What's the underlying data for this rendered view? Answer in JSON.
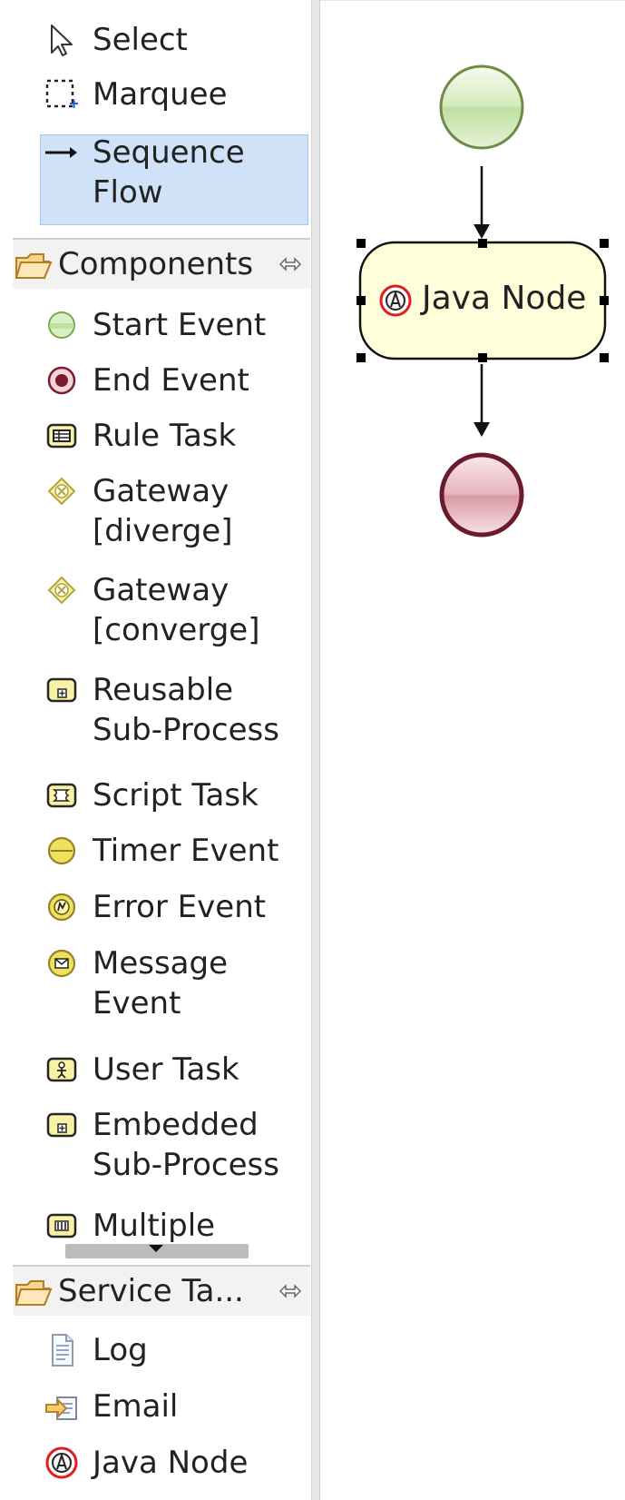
{
  "palette": {
    "tools": [
      {
        "name": "select",
        "label": "Select",
        "icon": "arrow-cursor-icon"
      },
      {
        "name": "marquee",
        "label": "Marquee",
        "icon": "dashed-marquee-icon"
      },
      {
        "name": "sequence-flow",
        "label_lines": [
          "Sequence",
          "Flow"
        ],
        "icon": "right-arrow-icon",
        "selected": true
      }
    ],
    "components_drawer": {
      "title": "Components",
      "items": [
        {
          "label": "Start Event",
          "icon": "start-event-icon"
        },
        {
          "label": "End Event",
          "icon": "end-event-icon"
        },
        {
          "label": "Rule Task",
          "icon": "rule-task-icon"
        },
        {
          "label_lines": [
            "Gateway",
            "[diverge]"
          ],
          "icon": "gateway-diverge-icon"
        },
        {
          "label_lines": [
            "Gateway",
            "[converge]"
          ],
          "icon": "gateway-converge-icon"
        },
        {
          "label_lines": [
            "Reusable",
            "Sub-Process"
          ],
          "icon": "reusable-subprocess-icon"
        },
        {
          "label": "Script Task",
          "icon": "script-task-icon"
        },
        {
          "label": "Timer Event",
          "icon": "timer-event-icon"
        },
        {
          "label": "Error Event",
          "icon": "error-event-icon"
        },
        {
          "label_lines": [
            "Message",
            "Event"
          ],
          "icon": "message-event-icon"
        },
        {
          "label": "User Task",
          "icon": "user-task-icon"
        },
        {
          "label_lines": [
            "Embedded",
            "Sub-Process"
          ],
          "icon": "embedded-subprocess-icon"
        },
        {
          "label": "Multiple",
          "icon": "multiple-instances-icon"
        }
      ]
    },
    "service_tasks_drawer": {
      "title": "Service Ta...",
      "items": [
        {
          "label": "Log",
          "icon": "log-document-icon"
        },
        {
          "label": "Email",
          "icon": "email-icon"
        },
        {
          "label": "Java Node",
          "icon": "java-node-icon"
        }
      ]
    }
  },
  "canvas": {
    "java_node": {
      "label": "Java Node",
      "selected": true
    }
  },
  "colors": {
    "selection": "#cfe2f7",
    "start_event": "#8ab64b",
    "end_event": "#7a1c2b",
    "task_fill": "#fefedb"
  }
}
